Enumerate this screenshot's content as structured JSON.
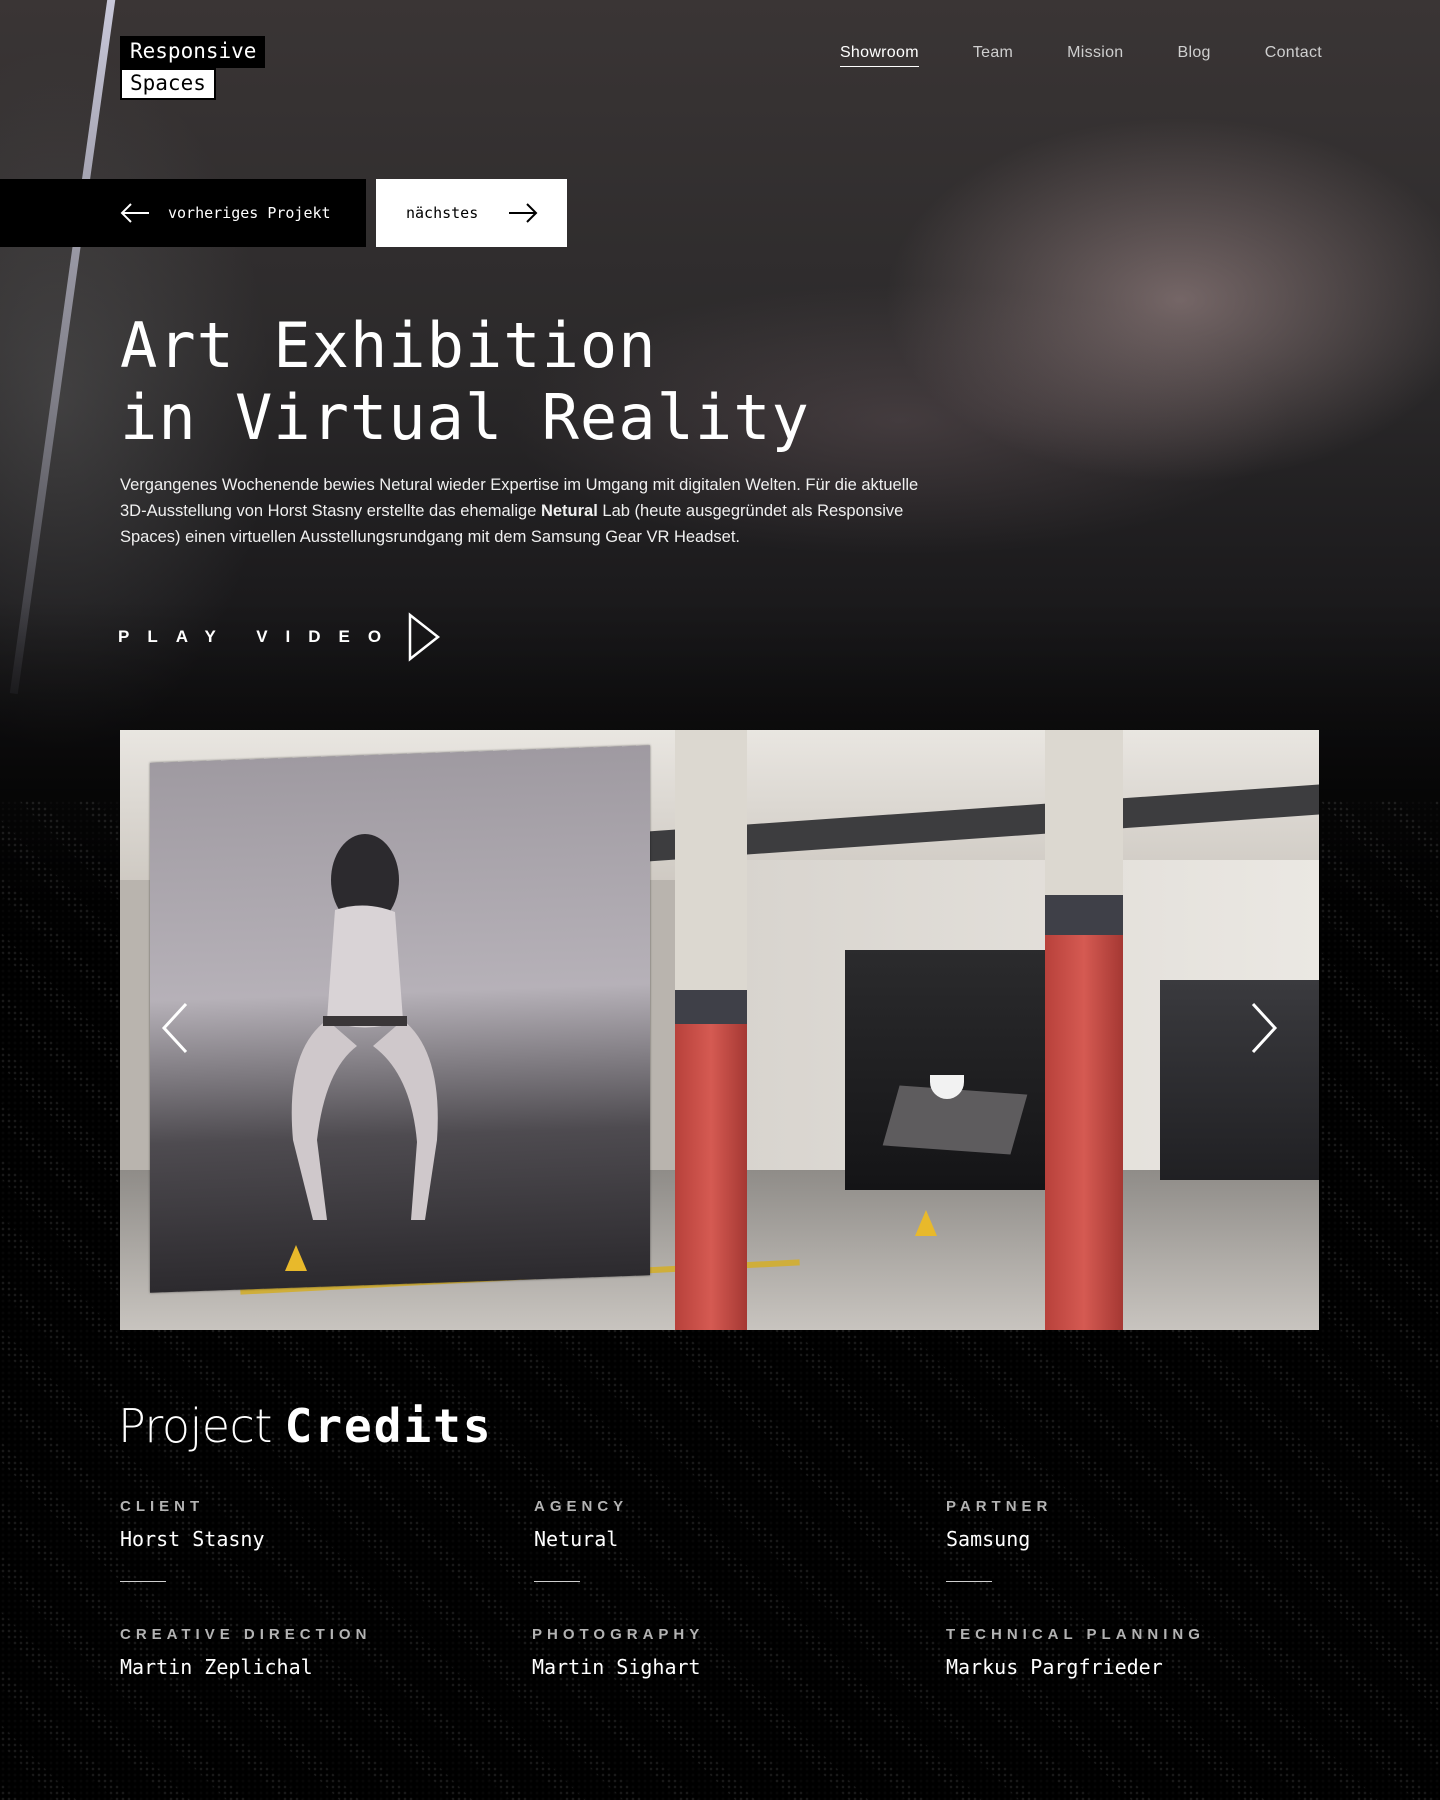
{
  "brand": {
    "line1": "Responsive",
    "line2": "Spaces"
  },
  "nav": {
    "items": [
      {
        "label": "Showroom",
        "active": true
      },
      {
        "label": "Team",
        "active": false
      },
      {
        "label": "Mission",
        "active": false
      },
      {
        "label": "Blog",
        "active": false
      },
      {
        "label": "Contact",
        "active": false
      }
    ]
  },
  "project_nav": {
    "prev_label": "vorheriges Projekt",
    "next_label": "nächstes"
  },
  "hero": {
    "title_line1": "Art Exhibition",
    "title_line2": "in Virtual Reality",
    "intro_part1": "Vergangenes Wochenende bewies Netural wieder Expertise im Umgang mit digitalen Welten. Für die aktuelle 3D-Ausstellung von Horst Stasny erstellte das ehemalige ",
    "intro_bold": "Netural",
    "intro_part2": " Lab (heute ausgegründet als Responsive Spaces) einen virtuellen Ausstellungsrundgang mit dem Samsung Gear VR Headset.",
    "play_label": "PLAY VIDEO"
  },
  "icons": {
    "prev_arrow": "arrow-left-icon",
    "next_arrow": "arrow-right-icon",
    "play": "play-triangle-icon",
    "slider_prev": "chevron-left-icon",
    "slider_next": "chevron-right-icon"
  },
  "credits": {
    "title_light": "Project",
    "title_strong": "Credits",
    "items": [
      {
        "role": "CLIENT",
        "name": "Horst Stasny"
      },
      {
        "role": "AGENCY",
        "name": "Netural"
      },
      {
        "role": "PARTNER",
        "name": "Samsung"
      },
      {
        "role": "CREATIVE DIRECTION",
        "name": "Martin Zeplichal"
      },
      {
        "role": "PHOTOGRAPHY",
        "name": "Martin Sighart"
      },
      {
        "role": "TECHNICAL PLANNING",
        "name": "Markus Pargfrieder"
      }
    ]
  },
  "colors": {
    "background": "#000000",
    "text": "#ffffff",
    "muted_label": "#b3b3b3",
    "pillar_red": "#c94b44"
  }
}
